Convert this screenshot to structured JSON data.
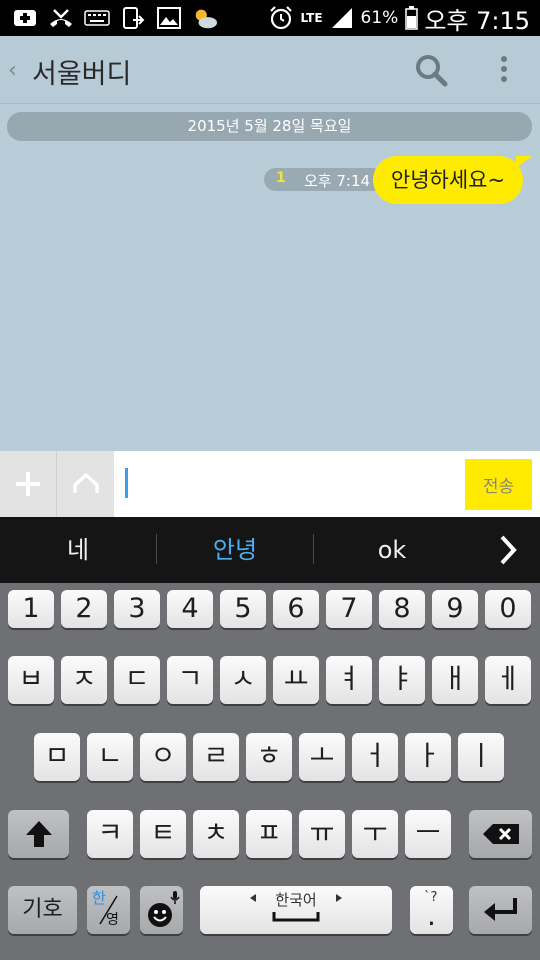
{
  "status_bar": {
    "lte": "LTE",
    "battery": "61%",
    "time": "오후 7:15"
  },
  "header": {
    "title": "서울버디",
    "back_icon": "‹"
  },
  "chat": {
    "date_divider": "2015년 5월 28일 목요일",
    "messages": [
      {
        "text": "안녕하세요~",
        "time": "오후 7:14",
        "unread": "1",
        "sender": "me"
      }
    ]
  },
  "input": {
    "value": "",
    "send_label": "전송"
  },
  "suggestions": [
    "네",
    "안녕",
    "ok"
  ],
  "keyboard": {
    "numbers": [
      "1",
      "2",
      "3",
      "4",
      "5",
      "6",
      "7",
      "8",
      "9",
      "0"
    ],
    "row1": [
      "ㅂ",
      "ㅈ",
      "ㄷ",
      "ㄱ",
      "ㅅ",
      "ㅛ",
      "ㅕ",
      "ㅑ",
      "ㅐ",
      "ㅔ"
    ],
    "row2": [
      "ㅁ",
      "ㄴ",
      "ㅇ",
      "ㄹ",
      "ㅎ",
      "ㅗ",
      "ㅓ",
      "ㅏ",
      "ㅣ"
    ],
    "row3": [
      "ㅋ",
      "ㅌ",
      "ㅊ",
      "ㅍ",
      "ㅠ",
      "ㅜ",
      "ㅡ"
    ],
    "symbols_label": "기호",
    "lang_toggle_top": "한",
    "lang_toggle_bottom": "영",
    "space_label": "한국어",
    "period_key": ".",
    "period_hint": "`?"
  },
  "colors": {
    "chat_bg": "#b9cdd8",
    "bubble": "#ffeb00",
    "accent": "#4aaef3"
  }
}
